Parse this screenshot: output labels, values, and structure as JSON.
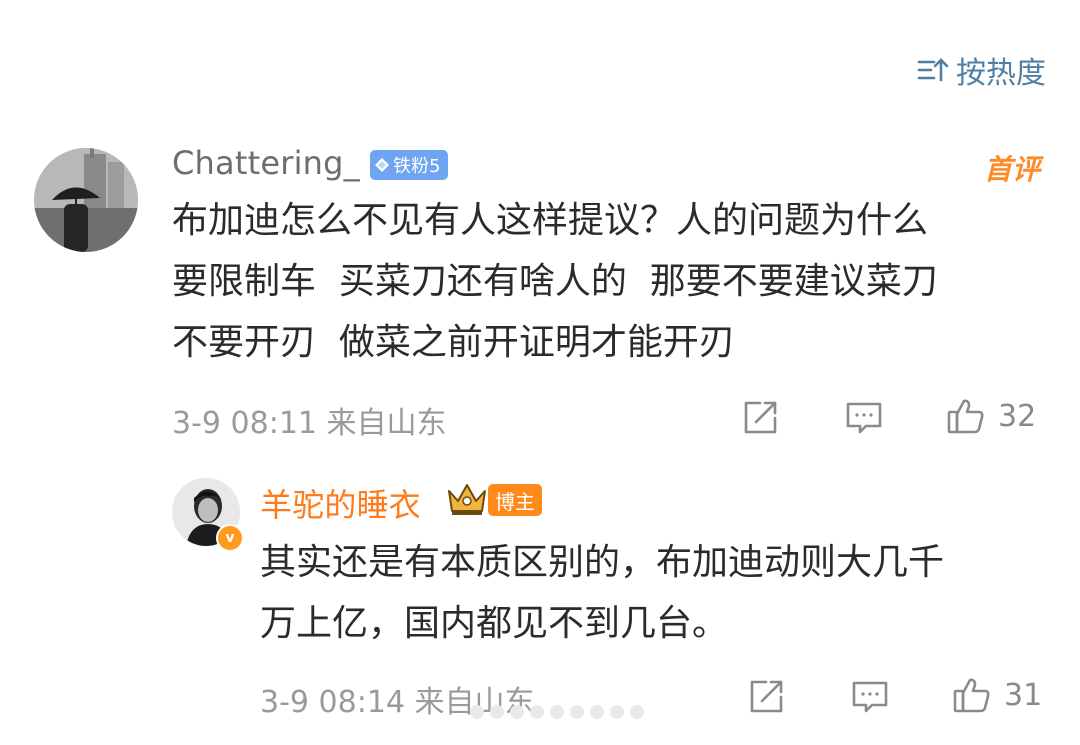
{
  "sort": {
    "label": "按热度",
    "icon": "sort-icon"
  },
  "comment": {
    "username": "Chattering_",
    "fan_badge": "铁粉5",
    "first_tag": "首评",
    "lines": [
      "布加迪怎么不见有人这样提议？人的问题为什么",
      "要限制车  买菜刀还有啥人的  那要不要建议菜刀",
      "不要开刃  做菜之前开证明才能开刃"
    ],
    "meta": "3-9 08:11 来自山东",
    "like_count": "32"
  },
  "reply": {
    "username": "羊驼的睡衣",
    "host_badge": "博主",
    "vip_mark": "v",
    "lines": [
      "其实还是有本质区别的，布加迪动则大几千",
      "万上亿，国内都见不到几台。"
    ],
    "meta": "3-9 08:14 来自山东",
    "like_count": "31"
  },
  "colors": {
    "link_blue": "#4f7fa5",
    "host_orange": "#ff7b1a",
    "fan_badge_blue": "#6ea4f0",
    "meta_gray": "#9a9a9a"
  }
}
